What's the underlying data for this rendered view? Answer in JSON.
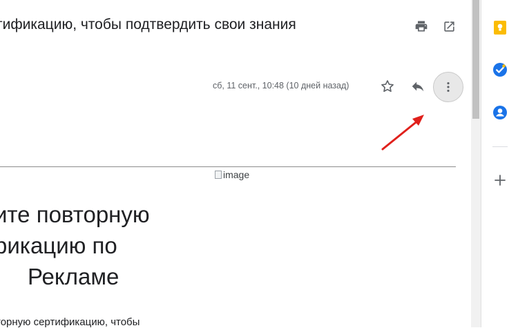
{
  "email": {
    "subject": "тификацию, чтобы подтвердить свои знания",
    "date": "сб, 11 сент., 10:48 (10 дней назад)",
    "broken_image_alt": "image",
    "headline_lines": [
      "ите повторную",
      "рикацию по",
      "Рекламе"
    ],
    "body_start": "торную сертификацию, чтобы"
  },
  "icons": {
    "print": "print-icon",
    "popout": "open-in-new-window-icon",
    "star": "star-icon",
    "reply": "reply-icon",
    "more": "more-vertical-icon",
    "annotation": "red-arrow-annotation",
    "keep": "keep-icon",
    "tasks": "tasks-icon",
    "contacts": "contacts-icon",
    "add": "plus-icon"
  },
  "colors": {
    "keep": "#fbbc04",
    "tasks": "#1a73e8",
    "contacts": "#1a73e8",
    "annotation_arrow": "#e0201b",
    "icon_gray": "#5f6368"
  }
}
